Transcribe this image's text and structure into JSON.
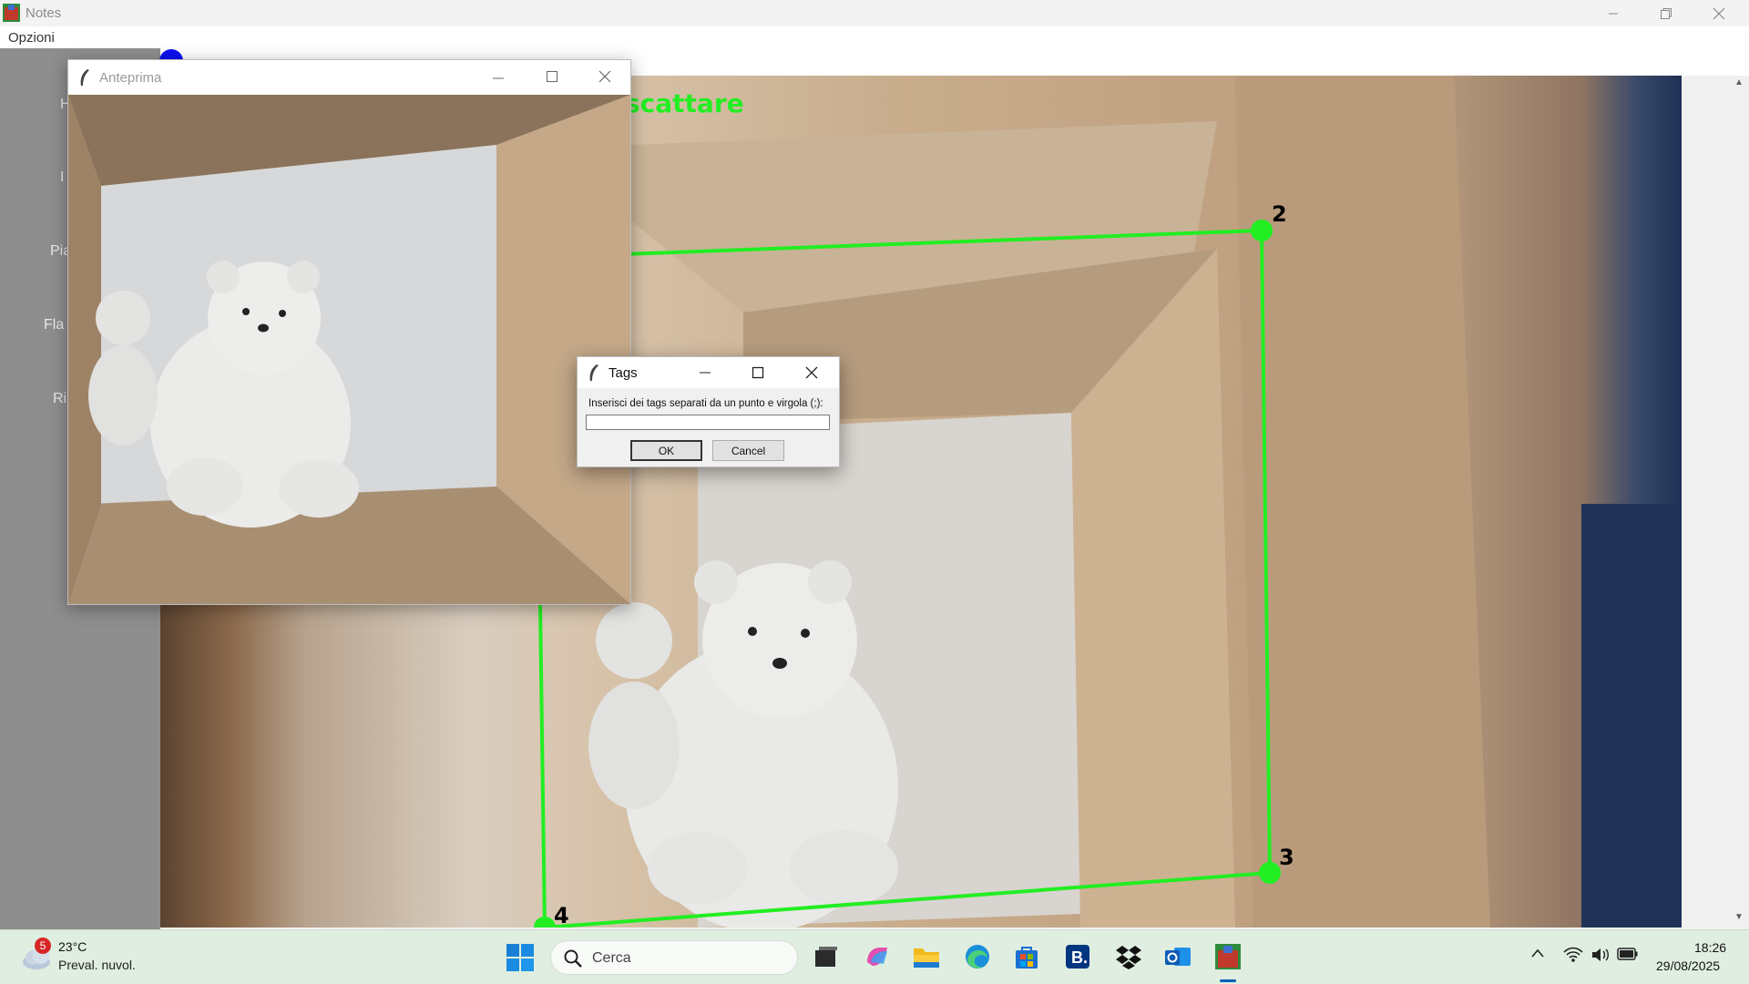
{
  "main_window": {
    "title": "Notes",
    "menu": [
      "Opzioni"
    ],
    "left_panel_labels": [
      "H",
      "I",
      "Pia",
      "Fla",
      "Ri"
    ]
  },
  "camera": {
    "overlay_text": "scattare",
    "corner_labels": [
      "2",
      "3",
      "4"
    ],
    "line_color": "#22ee22"
  },
  "preview_window": {
    "title": "Anteprima"
  },
  "tags_dialog": {
    "title": "Tags",
    "prompt": "Inserisci dei tags separati da un punto e virgola (;):",
    "input_value": "",
    "ok_label": "OK",
    "cancel_label": "Cancel"
  },
  "taskbar": {
    "weather_badge": "5",
    "weather_temp": "23°C",
    "weather_desc": "Preval. nuvol.",
    "search_placeholder": "Cerca",
    "apps": [
      "task-view-icon",
      "copilot-icon",
      "file-explorer-icon",
      "edge-icon",
      "store-icon",
      "booking-icon",
      "dropbox-icon",
      "outlook-icon",
      "notes-app-icon"
    ],
    "time": "18:26",
    "date": "29/08/2025"
  }
}
